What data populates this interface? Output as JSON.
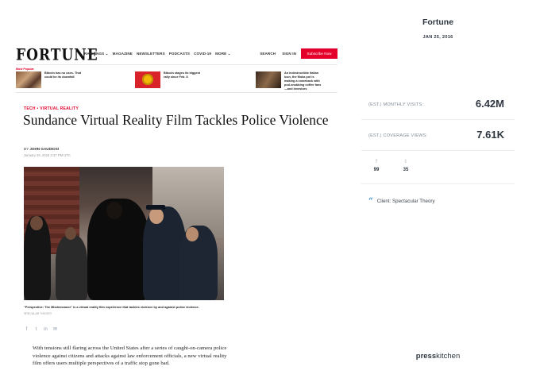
{
  "article": {
    "logo": "FORTUNE",
    "nav": [
      "RANKINGS ⌄",
      "MAGAZINE",
      "NEWSLETTERS",
      "PODCASTS",
      "COVID-19",
      "MORE ⌄"
    ],
    "search": "SEARCH",
    "signin": "SIGN IN",
    "subscribe": "Subscribe Now",
    "most_popular": "Most Popular",
    "promos": [
      {
        "text": "Bitcoin has no uses. That could be its downfall"
      },
      {
        "text": "Bitcoin stages its biggest rally since Feb. 8"
      },
      {
        "text": "An indestructible Italian icon, the Moka pot is making a comeback with pod-snubbing coffee fans—and investors"
      }
    ],
    "kicker": "TECH • VIRTUAL REALITY",
    "headline": "Sundance Virtual Reality Film Tackles Police Violence",
    "byline_prefix": "BY",
    "author": "JOHN GAUDIOSI",
    "dateline": "January 25, 2016 3:37 PM UTC",
    "caption": "\"Perspective: The Misdemeanor\" is a virtual reality film experience that tackles violence by and against police violence.",
    "credit": "SPECULAR THEORY",
    "body": "With tensions still flaring across the United States after a series of caught-on-camera police violence against citizens and attacks against law enforcement officials, a new virtual reality film offers users multiple perspectives of a traffic stop gone bad."
  },
  "panel": {
    "outlet": "Fortune",
    "date": "JAN 25, 2016",
    "stats": [
      {
        "label": "(EST.) MONTHLY VISITS:",
        "value": "6.42M"
      },
      {
        "label": "(EST.) COVERAGE VIEWS:",
        "value": "7.61K"
      }
    ],
    "social": [
      {
        "icon": "facebook-icon",
        "count": "99"
      },
      {
        "icon": "twitter-icon",
        "count": "35"
      }
    ],
    "client": "Client: Spectacular Theory",
    "brand_a": "press",
    "brand_b": "kitchen"
  },
  "colors": {
    "accent": "#e4002b",
    "quote": "#3a8fd6",
    "text_dark": "#2d3640"
  }
}
